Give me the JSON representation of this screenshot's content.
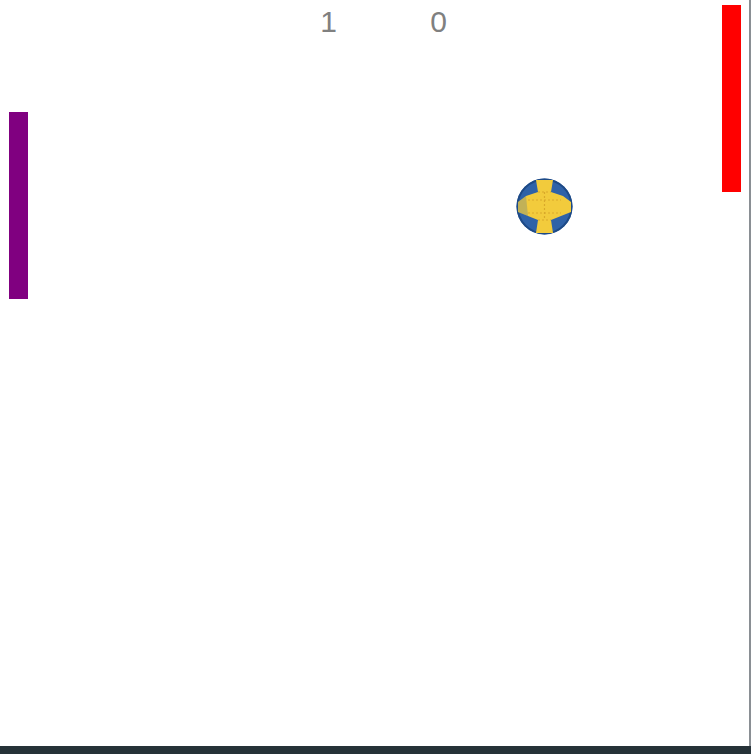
{
  "scores": [
    "1",
    "0"
  ],
  "paddles": [
    {
      "side": "left",
      "color": "#800080"
    },
    {
      "side": "right",
      "color": "#ff0000"
    }
  ]
}
